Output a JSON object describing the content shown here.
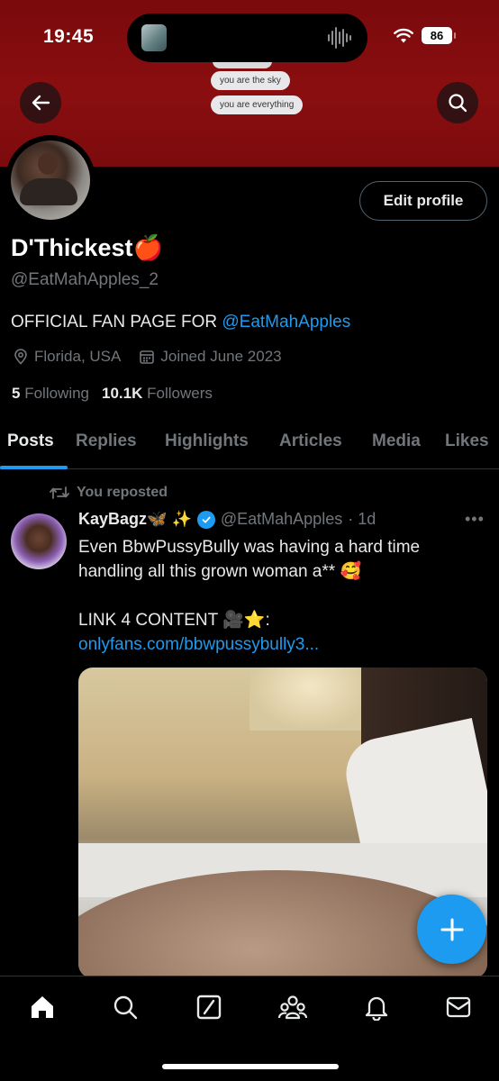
{
  "status_bar": {
    "time": "19:45",
    "battery": "86"
  },
  "banner": {
    "chat_lines": [
      "you are the sky",
      "you are everything"
    ]
  },
  "profile": {
    "display_name": "D'Thickest🍎",
    "handle": "@EatMahApples_2",
    "bio_text": "OFFICIAL FAN PAGE FOR ",
    "bio_link": "@EatMahApples",
    "location": "Florida, USA",
    "joined": "Joined June 2023",
    "following_count": "5",
    "following_label": "Following",
    "followers_count": "10.1K",
    "followers_label": "Followers",
    "edit_label": "Edit profile"
  },
  "tabs": [
    "Posts",
    "Replies",
    "Highlights",
    "Articles",
    "Media",
    "Likes"
  ],
  "post": {
    "repost_label": "You reposted",
    "author_name": "KayBagz🦋 ✨",
    "author_handle": "@EatMahApples",
    "time": "· 1d",
    "line1": "Even BbwPussyBully was having a hard time handling all this grown woman a** 🥰",
    "line2_text": "LINK 4 CONTENT 🎥⭐: ",
    "line2_link": "onlyfans.com/bbwpussybully3..."
  },
  "colors": {
    "accent": "#1d9bf0",
    "banner": "#8a0e10",
    "muted": "#71767b"
  },
  "icons": [
    "back-arrow-icon",
    "search-icon",
    "location-pin-icon",
    "calendar-icon",
    "repost-icon",
    "verified-icon",
    "more-icon",
    "compose-plus-icon",
    "home-icon",
    "explore-icon",
    "grok-icon",
    "communities-icon",
    "notifications-icon",
    "messages-icon"
  ]
}
